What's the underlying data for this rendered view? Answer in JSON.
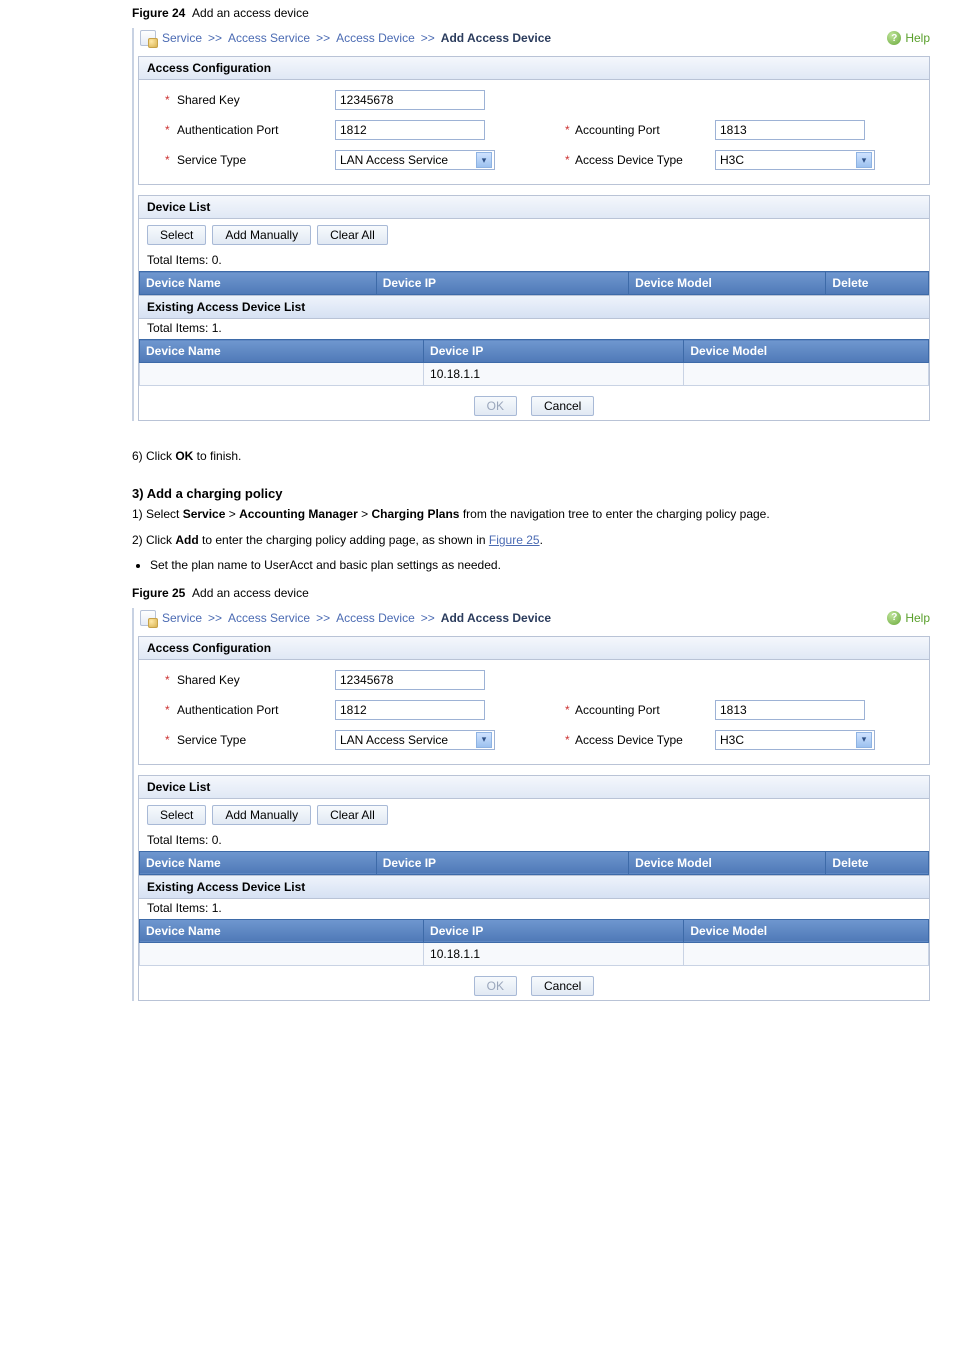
{
  "figures": [
    {
      "id": "fig24",
      "label": "Figure 24",
      "caption": "Add an access device"
    },
    {
      "id": "fig25",
      "label": "Figure 25",
      "caption": "Add an access device"
    }
  ],
  "breadcrumb": {
    "items": [
      "Service",
      "Access Service",
      "Access Device"
    ],
    "current": "Add Access Device"
  },
  "help": {
    "label": "Help"
  },
  "accessConfig": {
    "title": "Access Configuration",
    "sharedKey": {
      "label": "Shared Key",
      "value": "12345678"
    },
    "authPort": {
      "label": "Authentication Port",
      "value": "1812"
    },
    "acctPort": {
      "label": "Accounting Port",
      "value": "1813"
    },
    "serviceType": {
      "label": "Service Type",
      "value": "LAN Access Service"
    },
    "deviceType": {
      "label": "Access Device Type",
      "value": "H3C"
    }
  },
  "deviceList": {
    "title": "Device List",
    "buttons": {
      "select": "Select",
      "addManually": "Add Manually",
      "clearAll": "Clear All"
    },
    "total": "Total Items: 0.",
    "cols": {
      "name": "Device Name",
      "ip": "Device IP",
      "model": "Device Model",
      "del": "Delete"
    }
  },
  "existing": {
    "title": "Existing Access Device List",
    "total": "Total Items: 1.",
    "cols": {
      "name": "Device Name",
      "ip": "Device IP",
      "model": "Device Model"
    },
    "rows": [
      {
        "name": "",
        "ip": "10.18.1.1",
        "model": ""
      }
    ]
  },
  "actions": {
    "ok": "OK",
    "cancel": "Cancel"
  },
  "midtext": {
    "line1a": "6)        Click ",
    "line1b": "OK",
    "line1c": " to finish.",
    "h3": "3)    Add a charging policy",
    "step1": "1)        Select ",
    "step1b": "Service",
    "step1c": " > ",
    "step1d": "Accounting Manager",
    "step1e": " > ",
    "step1f": "Charging Plans",
    "step1g": " from the navigation tree to enter the charging policy page.",
    "step2a": "2)        Click ",
    "step2b": "Add",
    "step2c": " to enter the charging policy adding page, as shown in ",
    "step2link": "Figure 25",
    "step2d": ".",
    "bullet": "Set the plan name to ",
    "bulletb": "UserAcct",
    "bulletc": " and basic plan settings as needed."
  }
}
